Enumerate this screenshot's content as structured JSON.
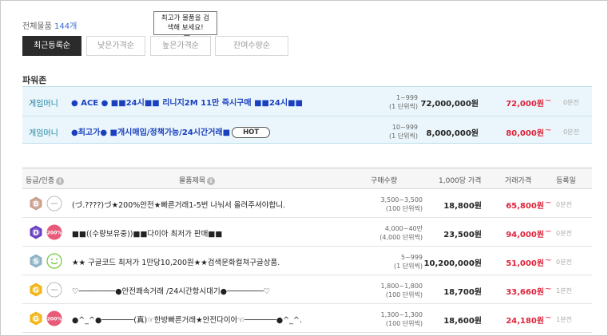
{
  "header": {
    "total_label": "전체물품",
    "total_count": "144개"
  },
  "tooltip": {
    "line1": "최고가 물품을 검",
    "line2": "색해 보세요!"
  },
  "sort_tabs": [
    "최근등록순",
    "낮은가격순",
    "높은가격순",
    "잔여수량순"
  ],
  "powerzone": {
    "title": "파워존",
    "rows": [
      {
        "category": "게임머니",
        "title": "● ACE ● ■■24시■■ 리니지2M 11만 즉시구매 ■■24시■■",
        "hot": "",
        "qty1": "1~999",
        "qty2": "(1 단위씩)",
        "price": "72,000,000원",
        "unit_price": "72,000원",
        "tilde": "~",
        "time": "0분전"
      },
      {
        "category": "게임머니",
        "title": "●최고가● ■개시매입/정책가능/24시간거래■",
        "hot": "HOT",
        "qty1": "10~999",
        "qty2": "(1 단위씩)",
        "price": "8,000,000원",
        "unit_price": "80,000원",
        "tilde": "~",
        "time": "0분전"
      }
    ]
  },
  "list": {
    "headers": {
      "grade": "등급/인증",
      "title": "물품제목",
      "qty": "구매수량",
      "price": "1,000당 가격",
      "unit": "거래가격",
      "time": "등록일"
    },
    "rows": [
      {
        "grade": "B",
        "grade_color": "#caa08f",
        "cert": "—",
        "cert_type": "none",
        "title": "(づ.????)づ★200%안전★빠른거래1-5번 나눠서 올려주셔야합니.",
        "qty1": "3,500~3,500",
        "qty2": "(100 단위씩)",
        "price": "18,800원",
        "unit_price": "65,800원",
        "tilde": "~",
        "time": "0분전"
      },
      {
        "grade": "D",
        "grade_color": "#6a3fc4",
        "cert": "200%",
        "cert_type": "pct",
        "title": "■■((수량보유중))■■다이아 최저가 판매■■",
        "qty1": "4,000~40만",
        "qty2": "(4,000 단위씩)",
        "price": "23,500원",
        "unit_price": "94,000원",
        "tilde": "~",
        "time": "0분전"
      },
      {
        "grade": "S",
        "grade_color": "#8fb3c7",
        "cert": "☺",
        "cert_type": "smile",
        "title": "★★ 구글코드 최저가 1만당10,200원★★검색문화컬쳐구글상품.",
        "qty1": "5~999",
        "qty2": "(1 단위씩)",
        "price": "10,200,000원",
        "unit_price": "51,000원",
        "tilde": "~",
        "time": "0분전"
      },
      {
        "grade": "G",
        "grade_color": "#f1b515",
        "cert": "—",
        "cert_type": "none",
        "title": "♡────────●안전쾌속거래 /24시간항시대기●────────♡",
        "qty1": "1,800~1,800",
        "qty2": "(100 단위씩)",
        "price": "18,700원",
        "unit_price": "33,660원",
        "tilde": "~",
        "time": "1분전"
      },
      {
        "grade": "G",
        "grade_color": "#f1b515",
        "cert": "200%",
        "cert_type": "pct",
        "title": "●^_^●───────(真)☞한방빠른거래★안전다이아☜───────●^_^.",
        "qty1": "1,300~1,300",
        "qty2": "(100 단위씩)",
        "price": "18,600원",
        "unit_price": "24,180원",
        "tilde": "~",
        "time": "1분전"
      }
    ]
  }
}
